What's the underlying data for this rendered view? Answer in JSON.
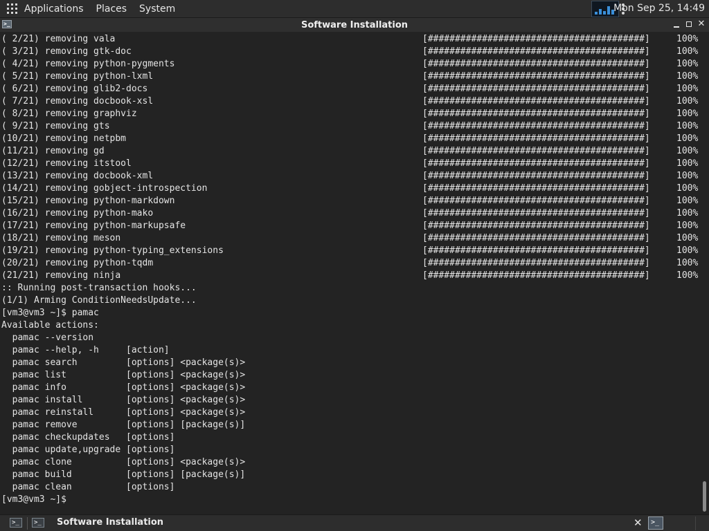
{
  "top_panel": {
    "menu": [
      "Applications",
      "Places",
      "System"
    ],
    "clock": "Mon Sep 25, 14:49"
  },
  "window": {
    "title": "Software Installation",
    "icon_label": ">_"
  },
  "terminal": {
    "lines": [
      {
        "text": "( 2/21) removing vala",
        "progress": "[########################################]",
        "percent": "100%"
      },
      {
        "text": "( 3/21) removing gtk-doc",
        "progress": "[########################################]",
        "percent": "100%"
      },
      {
        "text": "( 4/21) removing python-pygments",
        "progress": "[########################################]",
        "percent": "100%"
      },
      {
        "text": "( 5/21) removing python-lxml",
        "progress": "[########################################]",
        "percent": "100%"
      },
      {
        "text": "( 6/21) removing glib2-docs",
        "progress": "[########################################]",
        "percent": "100%"
      },
      {
        "text": "( 7/21) removing docbook-xsl",
        "progress": "[########################################]",
        "percent": "100%"
      },
      {
        "text": "( 8/21) removing graphviz",
        "progress": "[########################################]",
        "percent": "100%"
      },
      {
        "text": "( 9/21) removing gts",
        "progress": "[########################################]",
        "percent": "100%"
      },
      {
        "text": "(10/21) removing netpbm",
        "progress": "[########################################]",
        "percent": "100%"
      },
      {
        "text": "(11/21) removing gd",
        "progress": "[########################################]",
        "percent": "100%"
      },
      {
        "text": "(12/21) removing itstool",
        "progress": "[########################################]",
        "percent": "100%"
      },
      {
        "text": "(13/21) removing docbook-xml",
        "progress": "[########################################]",
        "percent": "100%"
      },
      {
        "text": "(14/21) removing gobject-introspection",
        "progress": "[########################################]",
        "percent": "100%"
      },
      {
        "text": "(15/21) removing python-markdown",
        "progress": "[########################################]",
        "percent": "100%"
      },
      {
        "text": "(16/21) removing python-mako",
        "progress": "[########################################]",
        "percent": "100%"
      },
      {
        "text": "(17/21) removing python-markupsafe",
        "progress": "[########################################]",
        "percent": "100%"
      },
      {
        "text": "(18/21) removing meson",
        "progress": "[########################################]",
        "percent": "100%"
      },
      {
        "text": "(19/21) removing python-typing_extensions",
        "progress": "[########################################]",
        "percent": "100%"
      },
      {
        "text": "(20/21) removing python-tqdm",
        "progress": "[########################################]",
        "percent": "100%"
      },
      {
        "text": "(21/21) removing ninja",
        "progress": "[########################################]",
        "percent": "100%"
      },
      {
        "text": ":: Running post-transaction hooks..."
      },
      {
        "text": "(1/1) Arming ConditionNeedsUpdate..."
      },
      {
        "text": "[vm3@vm3 ~]$ pamac"
      },
      {
        "text": "Available actions:"
      },
      {
        "text": "  pamac --version"
      },
      {
        "text": "  pamac --help, -h     [action]"
      },
      {
        "text": "  pamac search         [options] <package(s)>"
      },
      {
        "text": "  pamac list           [options] <package(s)>"
      },
      {
        "text": "  pamac info           [options] <package(s)>"
      },
      {
        "text": "  pamac install        [options] <package(s)>"
      },
      {
        "text": "  pamac reinstall      [options] <package(s)>"
      },
      {
        "text": "  pamac remove         [options] [package(s)]"
      },
      {
        "text": "  pamac checkupdates   [options]"
      },
      {
        "text": "  pamac update,upgrade [options]"
      },
      {
        "text": "  pamac clone          [options] <package(s)>"
      },
      {
        "text": "  pamac build          [options] [package(s)]"
      },
      {
        "text": "  pamac clean          [options]"
      },
      {
        "text": "[vm3@vm3 ~]$ "
      }
    ]
  },
  "taskbar": {
    "task_title": "Software Installation",
    "terminal_icon_label": ">_"
  }
}
